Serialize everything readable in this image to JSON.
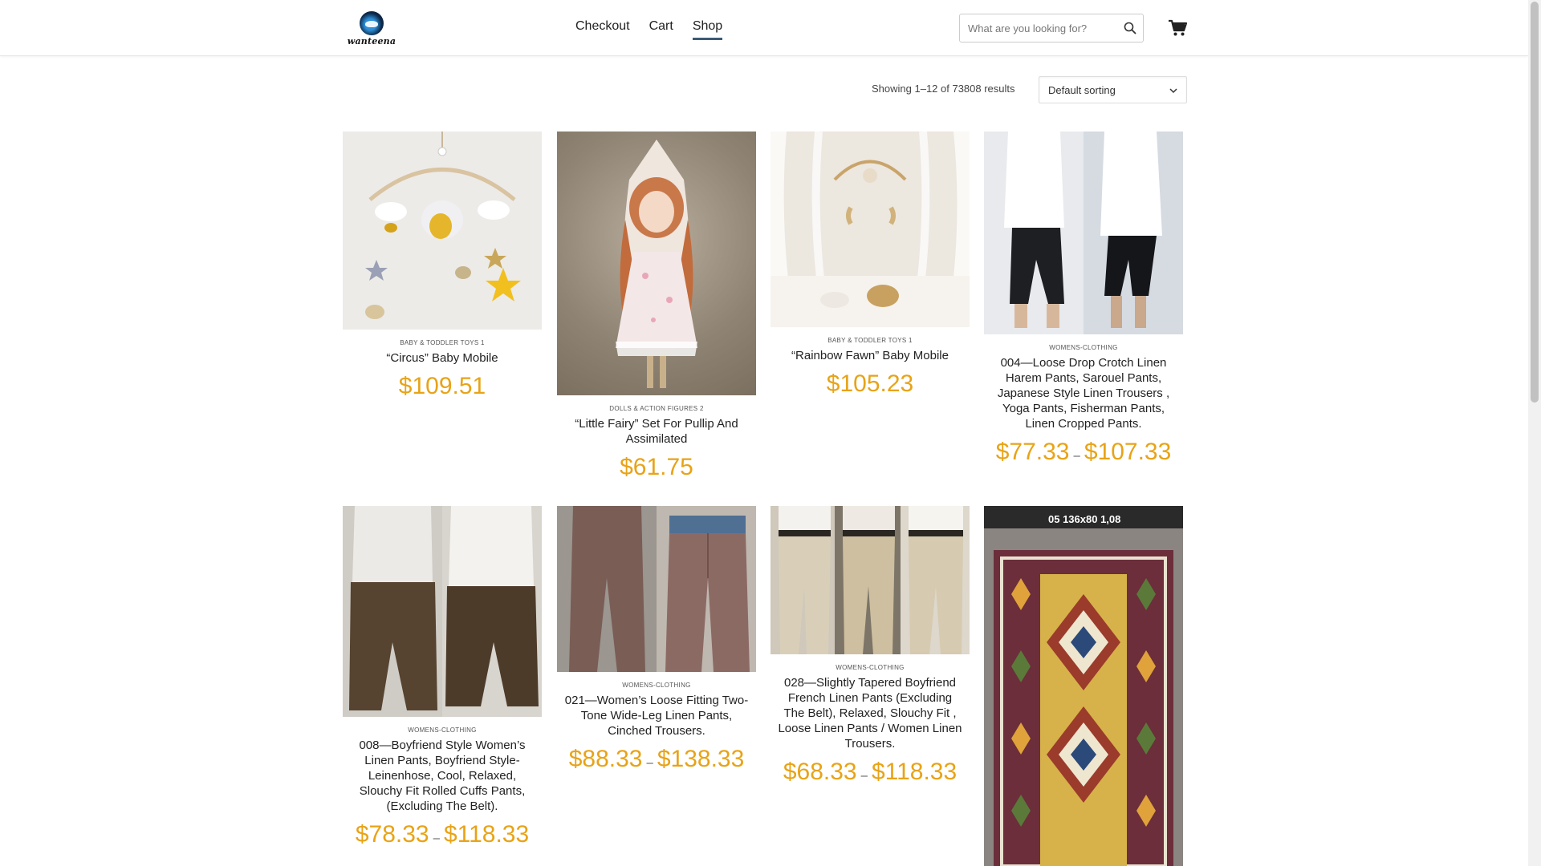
{
  "brand": {
    "logo_text": "wanteena"
  },
  "nav": {
    "checkout": "Checkout",
    "cart": "Cart",
    "shop": "Shop"
  },
  "search": {
    "placeholder": "What are you looking for?"
  },
  "toolbar": {
    "result_count": "Showing 1–12 of 73808 results",
    "sorting": "Default sorting"
  },
  "colors": {
    "price": "#e8a317",
    "nav_active_underline": "#3b5b75"
  },
  "products": [
    {
      "category": "BABY & TODDLER TOYS 1",
      "title": "“Circus” Baby Mobile",
      "price": "$109.51"
    },
    {
      "category": "DOLLS & ACTION FIGURES 2",
      "title": "“Little Fairy” Set For Pullip And Assimilated",
      "price": "$61.75"
    },
    {
      "category": "BABY & TODDLER TOYS 1",
      "title": "“Rainbow Fawn” Baby Mobile",
      "price": "$105.23"
    },
    {
      "category": "WOMENS-CLOTHING",
      "title": "004—Loose Drop Crotch Linen Harem Pants, Sarouel Pants, Japanese Style Linen Trousers , Yoga Pants, Fisherman Pants, Linen Cropped Pants.",
      "price_min": "$77.33",
      "price_max": "$107.33"
    },
    {
      "category": "WOMENS-CLOTHING",
      "title": "008—Boyfriend Style Women’s Linen Pants, Boyfriend Style-Leinenhose, Cool, Relaxed, Slouchy Fit Rolled Cuffs Pants,(Excluding The Belt).",
      "price_min": "$78.33",
      "price_max": "$118.33"
    },
    {
      "category": "WOMENS-CLOTHING",
      "title": "021—Women’s Loose Fitting Two-Tone Wide-Leg Linen Pants, Cinched Trousers.",
      "price_min": "$88.33",
      "price_max": "$138.33"
    },
    {
      "category": "WOMENS-CLOTHING",
      "title": "028—Slightly Tapered Boyfriend French Linen Pants (Excluding The Belt), Relaxed, Slouchy Fit , Loose Linen Pants / Women Linen Trousers.",
      "price_min": "$68.33",
      "price_max": "$118.33"
    },
    {
      "image_caption": "05 136x80 1,08"
    }
  ],
  "price_range_separator": "–"
}
